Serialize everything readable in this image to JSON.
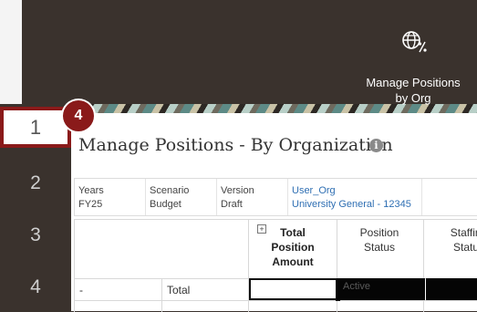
{
  "steps": [
    "1",
    "2",
    "3",
    "4"
  ],
  "active_step": "1",
  "callout_number": "4",
  "tile": {
    "label": "Manage Positions by Org",
    "icon": "globe-percent-icon"
  },
  "page": {
    "title": "Manage Positions - By Organization",
    "info_icon": "info-icon"
  },
  "pov": [
    {
      "label": "Years",
      "value": "FY25"
    },
    {
      "label": "Scenario",
      "value": "Budget"
    },
    {
      "label": "Version",
      "value": "Draft"
    },
    {
      "label": "User_Org",
      "value": "University General - 12345"
    }
  ],
  "grid": {
    "expand_symbol": "+",
    "headers": [
      "Total Position Amount",
      "Position Status",
      "Staffing Status"
    ],
    "rows": [
      {
        "col1": "-",
        "col2": "Total",
        "status": "Active"
      }
    ]
  },
  "colors": {
    "header_bg": "#3a322d",
    "callout": "#8a1a1a",
    "link": "#2f6fb3"
  }
}
